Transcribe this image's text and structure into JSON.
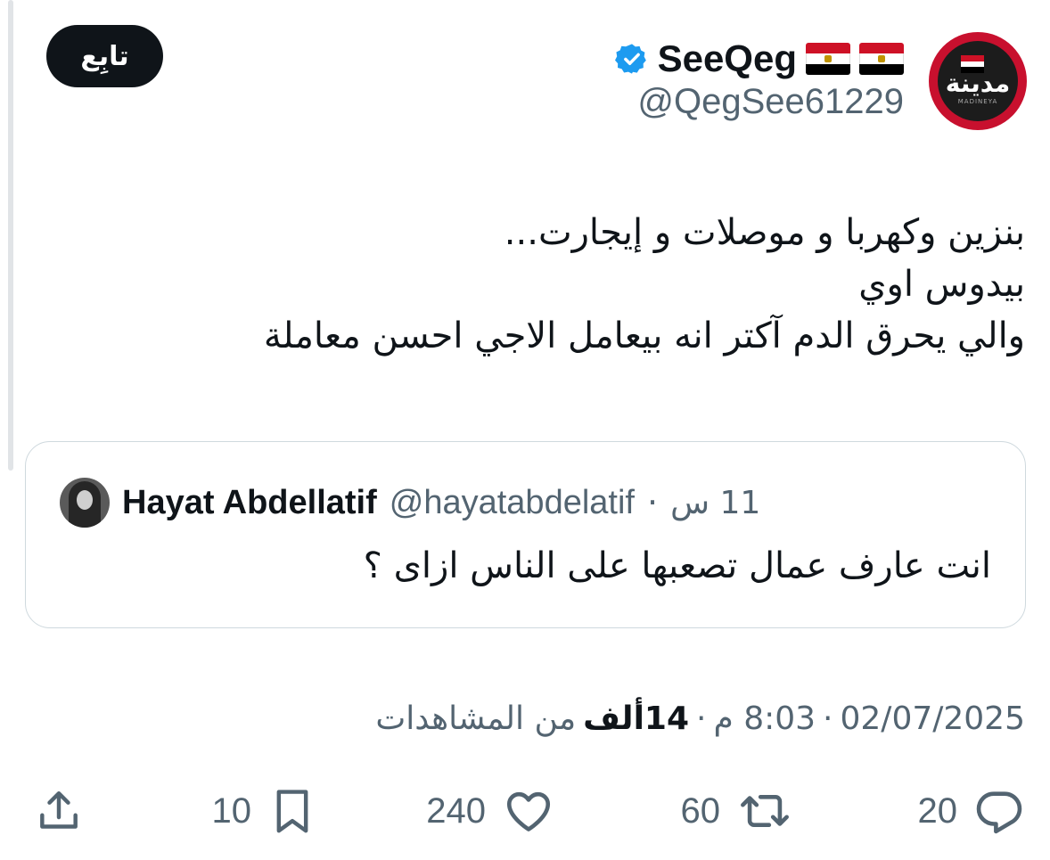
{
  "author": {
    "display_name": "SeeQeg",
    "handle": "@QegSee61229",
    "avatar_text": "مدينة",
    "avatar_subtext": "MADINEYA",
    "flags": [
      "egypt-flag",
      "egypt-flag"
    ]
  },
  "follow_button": {
    "label": "تابِع"
  },
  "tweet": {
    "lines": [
      "بنزين وكهربا و موصلات و إيجارت...",
      "بيدوس اوي",
      "والي يحرق الدم آكتر انه بيعامل الاجي احسن معاملة"
    ]
  },
  "quoted_tweet": {
    "name": "Hayat Abdellatif",
    "handle": "@hayatabdelatif",
    "separator": "·",
    "time": "11 س",
    "text": "انت عارف عمال تصعبها على الناس ازاى ؟"
  },
  "meta": {
    "time": "8:03 م",
    "separator": "·",
    "date": "02/07/2025",
    "views_count": "14ألف",
    "views_label": "من المشاهدات"
  },
  "actions": {
    "replies": "20",
    "reposts": "60",
    "likes": "240",
    "bookmarks": "10"
  },
  "colors": {
    "text_primary": "#0f1419",
    "text_secondary": "#536471",
    "verified_blue": "#1d9bf0",
    "border": "#cfd9de"
  }
}
